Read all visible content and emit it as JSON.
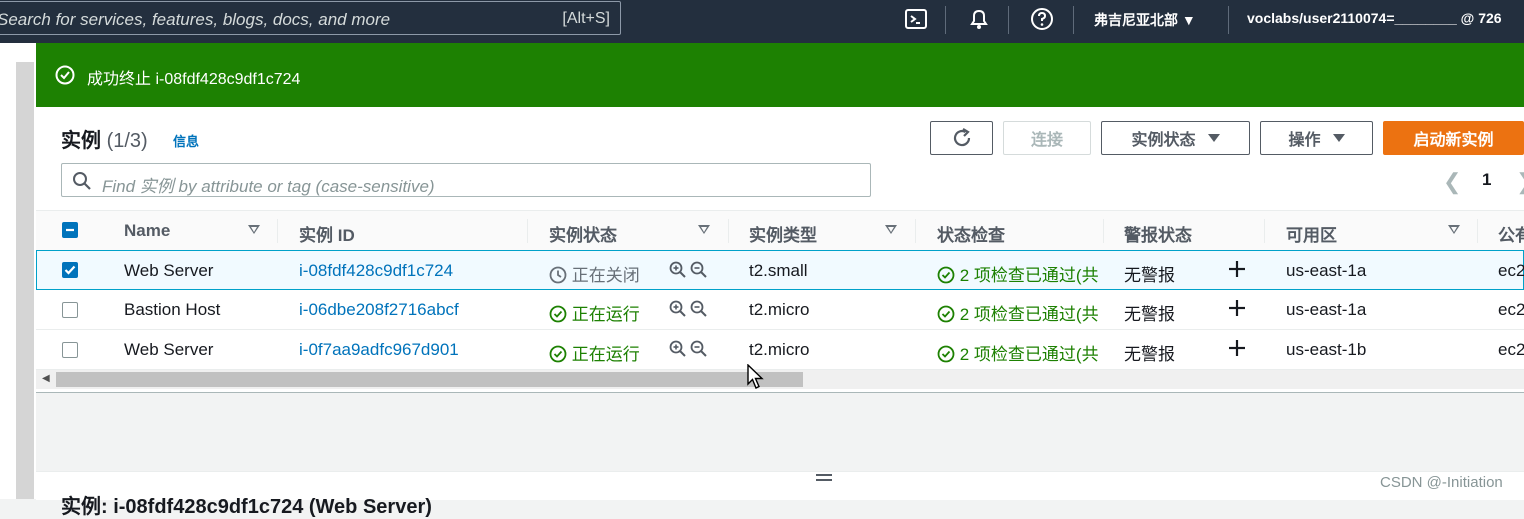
{
  "topbar": {
    "search_placeholder": "Search for services, features, blogs, docs, and more",
    "search_shortcut": "[Alt+S]",
    "region": "弗吉尼亚北部",
    "user": "voclabs/user2110074=________ @ 726"
  },
  "flash": {
    "message": "成功终止 i-08fdf428c9df1c724"
  },
  "header": {
    "title": "实例",
    "count": "(1/3)",
    "info": "信息",
    "connect": "连接",
    "instance_state": "实例状态",
    "actions": "操作",
    "launch": "启动新实例"
  },
  "filter": {
    "placeholder": "Find 实例 by attribute or tag (case-sensitive)"
  },
  "pagination": {
    "page": "1"
  },
  "columns": [
    "Name",
    "实例 ID",
    "实例状态",
    "实例类型",
    "状态检查",
    "警报状态",
    "可用区",
    "公有"
  ],
  "rows": [
    {
      "name": "Web Server",
      "id": "i-08fdf428c9df1c724",
      "state": "正在关闭",
      "type": "t2.small",
      "check": "2 项检查已通过(共",
      "alarm": "无警报",
      "az": "us-east-1a",
      "public": "ec2",
      "selected": true
    },
    {
      "name": "Bastion Host",
      "id": "i-06dbe208f2716abcf",
      "state": "正在运行",
      "type": "t2.micro",
      "check": "2 项检查已通过(共",
      "alarm": "无警报",
      "az": "us-east-1a",
      "public": "ec2",
      "selected": false
    },
    {
      "name": "Web Server",
      "id": "i-0f7aa9adfc967d901",
      "state": "正在运行",
      "type": "t2.micro",
      "check": "2 项检查已通过(共",
      "alarm": "无警报",
      "az": "us-east-1b",
      "public": "ec2",
      "selected": false
    }
  ],
  "details": {
    "title": "实例: i-08fdf428c9df1c724 (Web Server)"
  },
  "watermark": "CSDN @-Initiation",
  "colors": {
    "topbar": "#232f3e",
    "success": "#1d8102",
    "link": "#0073bb",
    "primary": "#ec7211"
  }
}
